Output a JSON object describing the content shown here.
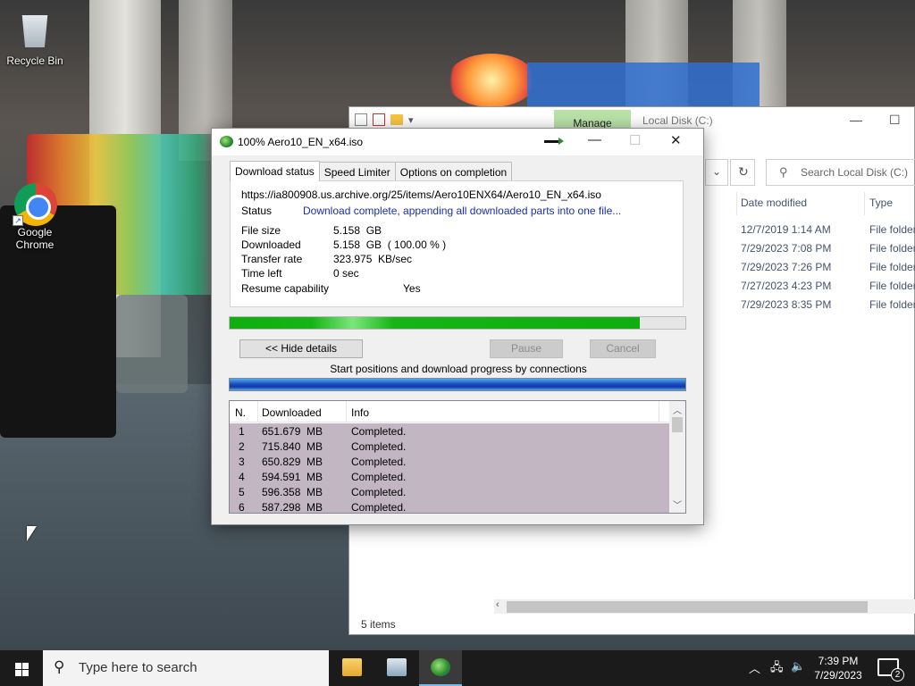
{
  "desktop": {
    "icons": [
      {
        "label": "Recycle Bin",
        "icon": "recycle-bin-icon"
      },
      {
        "label": "Google Chrome",
        "icon": "chrome-icon"
      }
    ]
  },
  "explorer": {
    "manage_label": "Manage",
    "title": "Local Disk (C:)",
    "search_placeholder": "Search Local Disk (C:)",
    "columns": [
      "Date modified",
      "Type"
    ],
    "rows": [
      {
        "date": "12/7/2019 1:14 AM",
        "type": "File folder"
      },
      {
        "date": "7/29/2023 7:08 PM",
        "type": "File folder"
      },
      {
        "date": "7/29/2023 7:26 PM",
        "type": "File folder"
      },
      {
        "date": "7/27/2023 4:23 PM",
        "type": "File folder"
      },
      {
        "date": "7/29/2023 8:35 PM",
        "type": "File folder"
      }
    ],
    "status": "5 items"
  },
  "download": {
    "title": "100% Aero10_EN_x64.iso",
    "tabs": [
      "Download status",
      "Speed Limiter",
      "Options on completion"
    ],
    "url": "https://ia800908.us.archive.org/25/items/Aero10ENX64/Aero10_EN_x64.iso",
    "labels": {
      "status": "Status",
      "file_size": "File size",
      "downloaded": "Downloaded",
      "transfer_rate": "Transfer rate",
      "time_left": "Time left",
      "resume": "Resume capability"
    },
    "values": {
      "status": "Download complete, appending all downloaded parts into one file...",
      "file_size": "5.158  GB",
      "downloaded": "5.158  GB  ( 100.00 % )",
      "transfer_rate": "323.975  KB/sec",
      "time_left": "0 sec",
      "resume": "Yes"
    },
    "progress_fraction": 0.9,
    "buttons": {
      "hide_details": "<< Hide details",
      "pause": "Pause",
      "cancel": "Cancel"
    },
    "connections_label": "Start positions and download progress by connections",
    "grid": {
      "columns": [
        "N.",
        "Downloaded",
        "Info"
      ],
      "rows": [
        {
          "n": "1",
          "downloaded": "651.679  MB",
          "info": "Completed."
        },
        {
          "n": "2",
          "downloaded": "715.840  MB",
          "info": "Completed."
        },
        {
          "n": "3",
          "downloaded": "650.829  MB",
          "info": "Completed."
        },
        {
          "n": "4",
          "downloaded": "594.591  MB",
          "info": "Completed."
        },
        {
          "n": "5",
          "downloaded": "596.358  MB",
          "info": "Completed."
        },
        {
          "n": "6",
          "downloaded": "587.298  MB",
          "info": "Completed."
        }
      ]
    }
  },
  "taskbar": {
    "search_placeholder": "Type here to search",
    "time": "7:39 PM",
    "date": "7/29/2023",
    "notification_count": "2"
  }
}
